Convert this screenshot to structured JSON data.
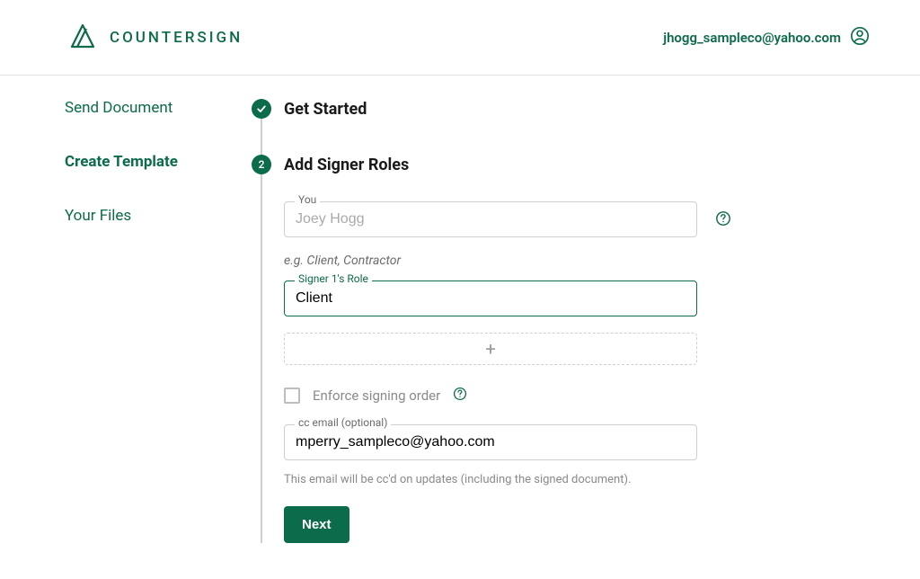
{
  "brand": {
    "name": "COUNTERSIGN"
  },
  "user": {
    "email": "jhogg_sampleco@yahoo.com"
  },
  "sidebar": {
    "items": [
      {
        "label": "Send Document"
      },
      {
        "label": "Create Template"
      },
      {
        "label": "Your Files"
      }
    ]
  },
  "steps": {
    "s1": {
      "title": "Get Started"
    },
    "s2": {
      "number": "2",
      "title": "Add Signer Roles",
      "you_label": "You",
      "you_value": "Joey Hogg",
      "hint": "e.g. Client, Contractor",
      "role1_label": "Signer 1's Role",
      "role1_value": "Client",
      "add_icon": "+",
      "enforce_label": "Enforce signing order",
      "cc_label": "cc email (optional)",
      "cc_value": "mperry_sampleco@yahoo.com",
      "cc_caption": "This email will be cc'd on updates (including the signed document).",
      "next": "Next"
    }
  }
}
